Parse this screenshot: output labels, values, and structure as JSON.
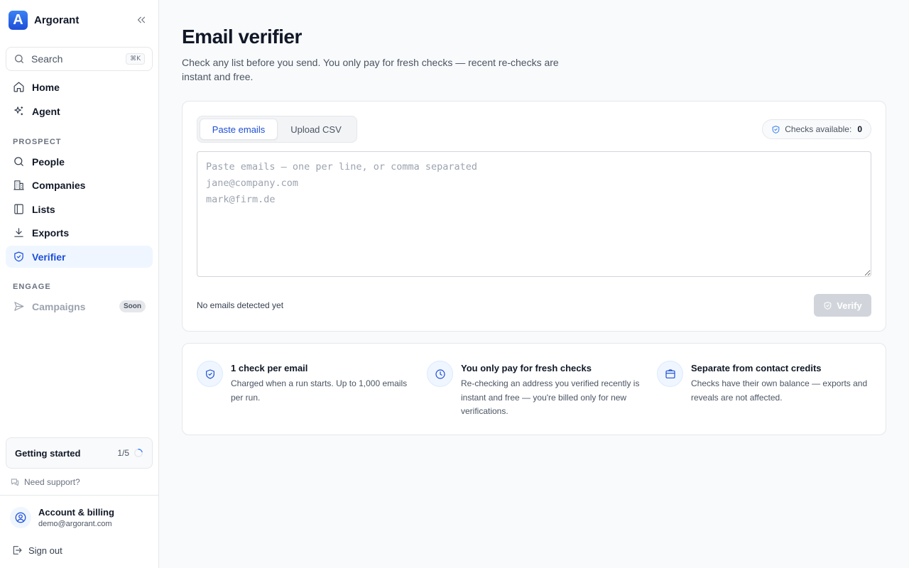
{
  "app": {
    "name": "Argorant"
  },
  "search": {
    "placeholder": "Search",
    "shortcut": "⌘K"
  },
  "sidebar": {
    "top_items": [
      {
        "label": "Home",
        "icon": "home-icon"
      },
      {
        "label": "Agent",
        "icon": "sparkles-icon"
      }
    ],
    "prospect_section": "PROSPECT",
    "prospect_items": [
      {
        "label": "People",
        "icon": "search-icon"
      },
      {
        "label": "Companies",
        "icon": "building-icon"
      },
      {
        "label": "Lists",
        "icon": "book-icon"
      },
      {
        "label": "Exports",
        "icon": "download-icon"
      },
      {
        "label": "Verifier",
        "icon": "shield-check-icon",
        "active": true
      }
    ],
    "engage_section": "ENGAGE",
    "engage_items": [
      {
        "label": "Campaigns",
        "icon": "send-icon",
        "badge": "Soon",
        "disabled": true
      }
    ],
    "getting_started": {
      "label": "Getting started",
      "progress": "1/5",
      "fraction": 0.2
    },
    "support": "Need support?",
    "account": {
      "name": "Account & billing",
      "email": "demo@argorant.com"
    },
    "sign_out": "Sign out"
  },
  "main": {
    "title": "Email verifier",
    "subtitle": "Check any list before you send. You only pay for fresh checks — recent re-checks are instant and free.",
    "tabs": [
      {
        "label": "Paste emails",
        "active": true
      },
      {
        "label": "Upload CSV",
        "active": false
      }
    ],
    "checks": {
      "label": "Checks available:",
      "value": "0"
    },
    "textarea": {
      "value": "",
      "placeholder": "Paste emails — one per line, or comma separated\njane@company.com\nmark@firm.de"
    },
    "detected": "No emails detected yet",
    "verify_label": "Verify",
    "info": [
      {
        "icon": "shield-check-icon",
        "title": "1 check per email",
        "body": "Charged when a run starts. Up to 1,000 emails per run."
      },
      {
        "icon": "clock-icon",
        "title": "You only pay for fresh checks",
        "body": "Re-checking an address you verified recently is instant and free — you're billed only for new verifications."
      },
      {
        "icon": "wallet-icon",
        "title": "Separate from contact credits",
        "body": "Checks have their own balance — exports and reveals are not affected."
      }
    ]
  },
  "colors": {
    "accent": "#1d4ed8",
    "accent_bg": "#eff6ff",
    "disabled_button": "#d1d5db"
  }
}
